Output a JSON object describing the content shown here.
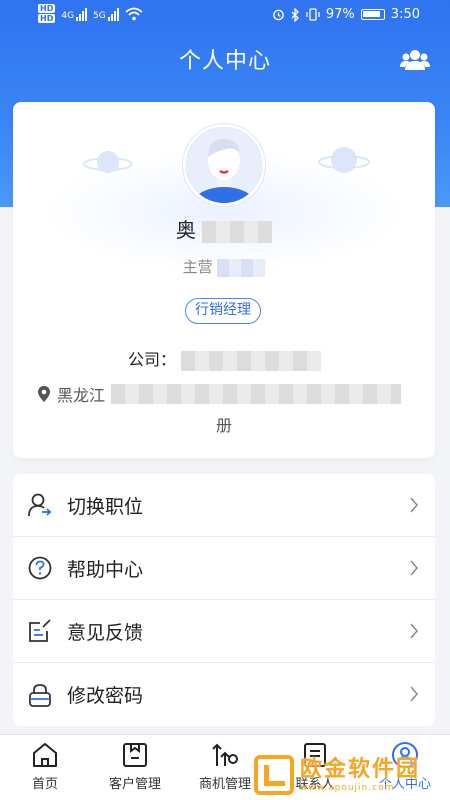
{
  "status_bar": {
    "net1": "4G",
    "net2": "5G",
    "battery": "97%",
    "time": "3:50"
  },
  "header": {
    "title": "个人中心",
    "right_icon": "team-icon"
  },
  "profile": {
    "name": "奥",
    "subtitle": "主营",
    "role": "行销经理",
    "company_label": "公司：",
    "address_prefix": "黑龙江",
    "address_tail": "册"
  },
  "menu": [
    {
      "label": "切换职位",
      "icon": "switch-role-icon"
    },
    {
      "label": "帮助中心",
      "icon": "help-icon"
    },
    {
      "label": "意见反馈",
      "icon": "feedback-icon"
    },
    {
      "label": "修改密码",
      "icon": "lock-icon"
    }
  ],
  "tabs": [
    {
      "label": "首页",
      "icon": "home-icon",
      "active": false
    },
    {
      "label": "客户管理",
      "icon": "customer-icon",
      "active": false
    },
    {
      "label": "商机管理",
      "icon": "opportunity-icon",
      "active": false
    },
    {
      "label": "联系人",
      "icon": "contacts-icon",
      "active": false
    },
    {
      "label": "个人中心",
      "icon": "profile-icon",
      "active": true
    }
  ],
  "watermark": {
    "text": "欧金软件园",
    "url": "www.apoujin.com"
  },
  "colors": {
    "primary": "#2f73f0",
    "accent": "#2d6ee8",
    "watermark": "#f5a623"
  }
}
